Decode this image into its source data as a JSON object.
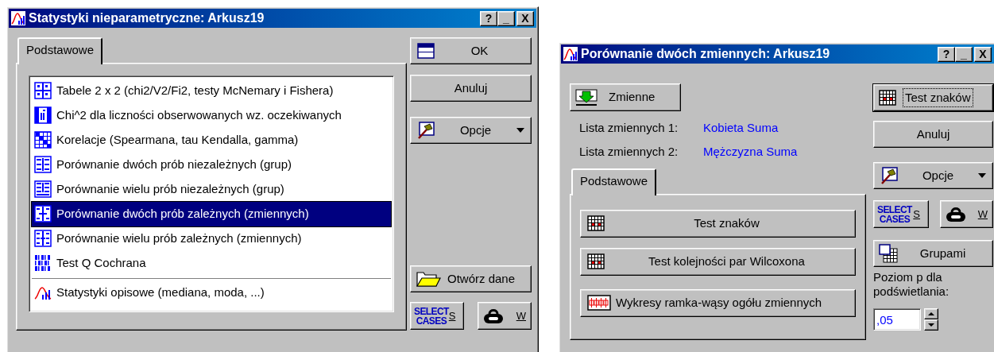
{
  "main_dialog": {
    "title": "Statystyki nieparametryczne: Arkusz19",
    "title_buttons": [
      "?",
      "_",
      "X"
    ],
    "tabs": [
      {
        "label": "Podstawowe",
        "selected": true
      }
    ],
    "items": [
      {
        "label": "Tabele 2 x 2 (chi2/V2/Fi2, testy McNemary i Fishera)",
        "selected": false
      },
      {
        "label": "Chi^2 dla liczności obserwowanych wz. oczekiwanych",
        "selected": false
      },
      {
        "label": "Korelacje (Spearmana, tau Kendalla, gamma)",
        "selected": false
      },
      {
        "label": "Porównanie dwóch prób niezależnych (grup)",
        "selected": false
      },
      {
        "label": "Porównanie wielu prób niezależnych (grup)",
        "selected": false
      },
      {
        "label": "Porównanie dwóch prób zależnych (zmiennych)",
        "selected": true
      },
      {
        "label": "Porównanie wielu prób zależnych (zmiennych)",
        "selected": false
      },
      {
        "label": "Test Q Cochrana",
        "selected": false
      }
    ],
    "footer_items": [
      {
        "label": "Statystyki opisowe (mediana, moda, ...)",
        "selected": false
      }
    ],
    "ok": "OK",
    "cancel": "Anuluj",
    "options": "Opcje",
    "open_data": "Otwórz dane",
    "select_cases": {
      "caption": [
        "SELECT",
        "CASES"
      ],
      "key": "S"
    },
    "weight_key": "W"
  },
  "compare_dialog": {
    "title": "Porównanie dwóch zmiennych: Arkusz19",
    "title_buttons": [
      "?",
      "_",
      "X"
    ],
    "variables_button": "Zmienne",
    "variable_lists": [
      {
        "label": "Lista zmiennych 1:",
        "value": "Kobieta Suma"
      },
      {
        "label": "Lista zmiennych 2:",
        "value": "Mężczyzna Suma"
      }
    ],
    "tabs": [
      {
        "label": "Podstawowe",
        "selected": true
      }
    ],
    "actions": [
      {
        "label": "Test znaków",
        "kind": "grid"
      },
      {
        "label": "Test kolejności par Wilcoxona",
        "kind": "grid"
      },
      {
        "label": "Wykresy ramka-wąsy ogółu zmiennych",
        "kind": "boxplot"
      }
    ],
    "default_button": "Test znaków",
    "cancel": "Anuluj",
    "options": "Opcje",
    "select_cases": {
      "caption": [
        "SELECT",
        "CASES"
      ],
      "key": "S"
    },
    "weight_key": "W",
    "group_button": "Grupami",
    "p_level_label": "Poziom p dla podświetlania:",
    "p_level_value": ",05"
  }
}
